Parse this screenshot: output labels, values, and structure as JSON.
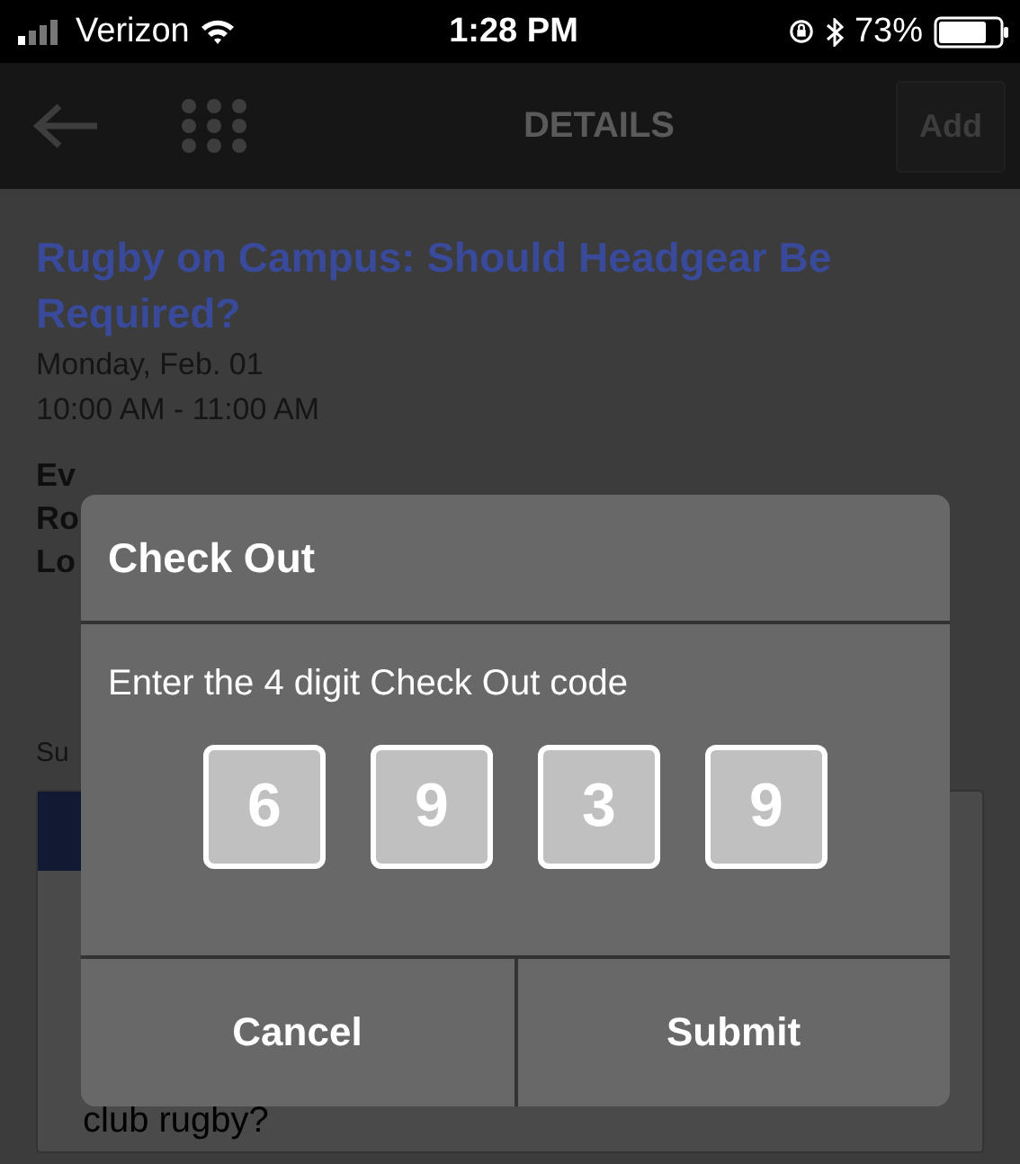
{
  "status_bar": {
    "carrier": "Verizon",
    "time": "1:28 PM",
    "battery": "73%"
  },
  "nav": {
    "title": "DETAILS",
    "action": "Add"
  },
  "event": {
    "title": "Rugby on Campus: Should Headgear Be Required?",
    "date": "Monday, Feb. 01",
    "time": "10:00 AM - 11:00 AM",
    "detail_lines": [
      "Ev",
      "Ro",
      "Lo"
    ],
    "summary_label": "Su",
    "tabs": [
      {
        "selected": true
      }
    ],
    "description": "club rugby?"
  },
  "dialog": {
    "title": "Check Out",
    "prompt": "Enter the 4 digit Check Out code",
    "code": [
      "6",
      "9",
      "3",
      "9"
    ],
    "buttons": [
      "Cancel",
      "Submit"
    ]
  }
}
